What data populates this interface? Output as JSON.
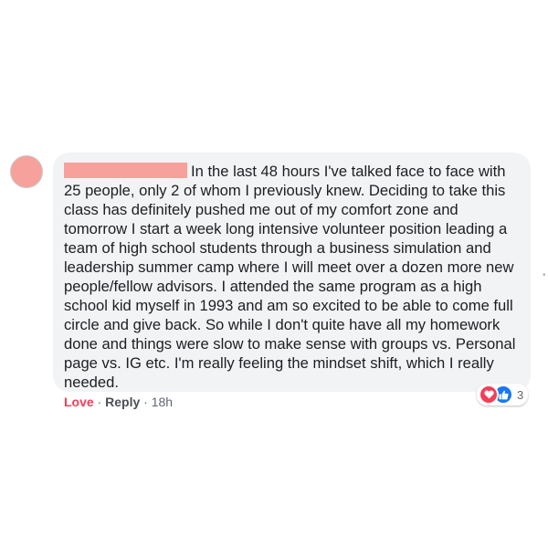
{
  "comment": {
    "author_name_redacted": true,
    "text": "In the last 48 hours I've talked face to face with 25 people, only 2 of whom I previously knew. Deciding to take this class has definitely pushed me out of my comfort zone and tomorrow I start a week long intensive volunteer position leading a team of high school students through a business simulation and leadership summer camp where I will meet over a dozen more new people/fellow advisors. I attended the same program as a high school kid myself in 1993 and am so excited to be able to come full circle and give back. So while I don't quite have all my homework done and things were slow to make sense with groups vs. Personal page vs. IG etc. I'm really feeling the mindset shift, which I really needed."
  },
  "actions": {
    "love_label": "Love",
    "separator": "·",
    "reply_label": "Reply",
    "timestamp": "18h"
  },
  "reactions": {
    "icons": [
      "love-icon",
      "like-icon"
    ],
    "count": "3",
    "love_color": "#f33e58",
    "like_color": "#1877f2"
  },
  "colors": {
    "bubble_background": "#f2f3f5",
    "redaction": "#f6a19c"
  }
}
